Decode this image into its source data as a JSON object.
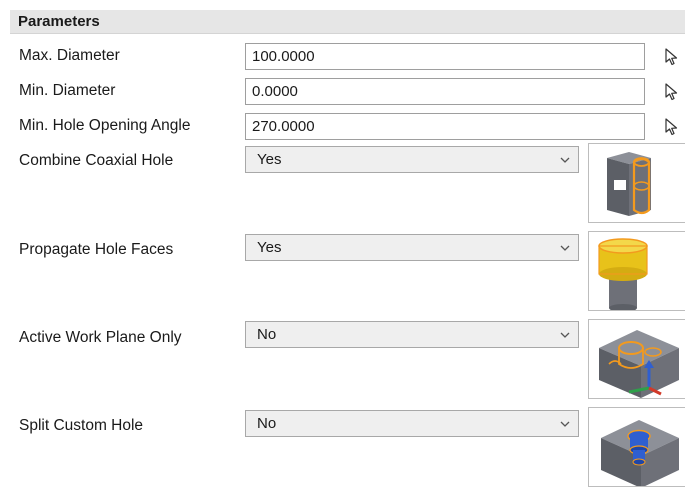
{
  "header": {
    "title": "Parameters"
  },
  "fields": [
    {
      "label": "Max. Diameter",
      "value": "100.0000"
    },
    {
      "label": "Min. Diameter",
      "value": "0.0000"
    },
    {
      "label": "Min. Hole Opening Angle",
      "value": "270.0000"
    }
  ],
  "options": [
    {
      "label": "Combine Coaxial Hole",
      "value": "Yes",
      "preview_icon": "coaxial-hole-preview-icon"
    },
    {
      "label": "Propagate Hole Faces",
      "value": "Yes",
      "preview_icon": "propagate-hole-faces-preview-icon"
    },
    {
      "label": "Active Work Plane Only",
      "value": "No",
      "preview_icon": "active-work-plane-preview-icon"
    },
    {
      "label": "Split Custom Hole",
      "value": "No",
      "preview_icon": "split-custom-hole-preview-icon"
    }
  ],
  "colors": {
    "header_bg": "#e6e6e6",
    "highlight_orange": "#f39a1e",
    "body_gray": "#6e7078",
    "cap_yellow": "#e8c21a",
    "hole_blue": "#2f5fd0"
  }
}
